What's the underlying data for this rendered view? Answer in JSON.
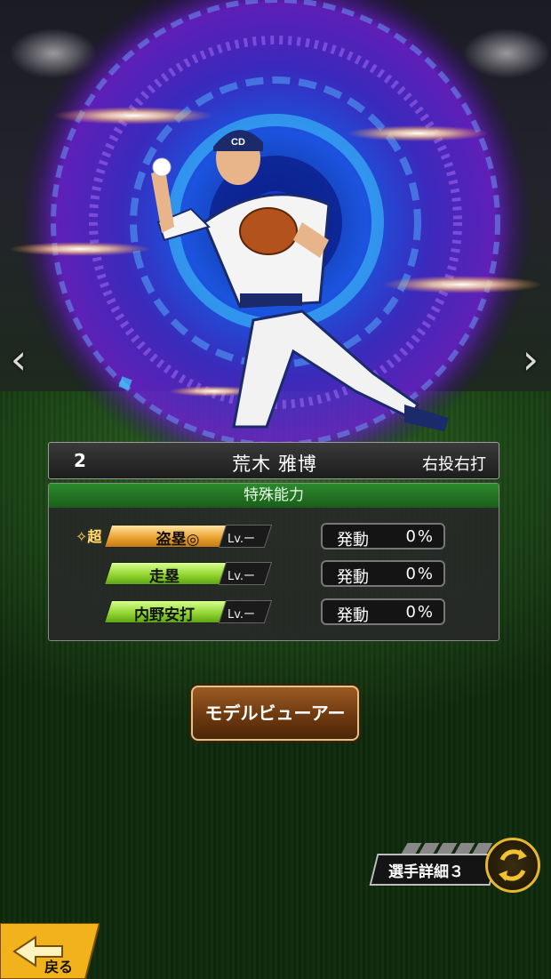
{
  "player": {
    "number": "2",
    "name": "荒木 雅博",
    "handedness": "右投右打",
    "cap_logo": "CD"
  },
  "abilities": {
    "header": "特殊能力",
    "super_badge": "✧超",
    "items": [
      {
        "name": "盗塁◎",
        "level": "Lv.ー",
        "activate_label": "発動",
        "activate_value": "0%",
        "tier": "gold"
      },
      {
        "name": "走塁",
        "level": "Lv.ー",
        "activate_label": "発動",
        "activate_value": "0%",
        "tier": "green"
      },
      {
        "name": "内野安打",
        "level": "Lv.ー",
        "activate_label": "発動",
        "activate_value": "0%",
        "tier": "green"
      }
    ]
  },
  "buttons": {
    "model_viewer": "モデルビューアー",
    "player_detail": "選手詳細３",
    "back": "戻る"
  },
  "icons": {
    "prev": "chevron-left-icon",
    "next": "chevron-right-icon",
    "swap": "swap-arrows-icon",
    "back": "back-arrow-icon"
  },
  "colors": {
    "ability_header": "#1f6e1f",
    "gold_tag": "#e89f2c",
    "green_tag": "#8fd22c",
    "model_button": "#6e3a10",
    "swap_ring": "#e8b82c",
    "back_button": "#f2b21b"
  }
}
